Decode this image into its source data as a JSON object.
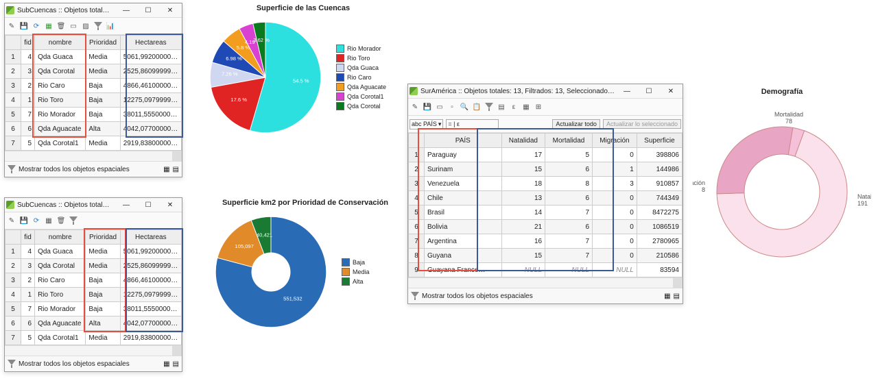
{
  "win1": {
    "title": "SubCuencas :: Objetos total…",
    "status": "Mostrar todos los objetos espaciales",
    "cols": [
      "fid",
      "nombre",
      "Prioridad",
      "Hectareas"
    ],
    "rows": [
      {
        "n": "1",
        "fid": "4",
        "nombre": "Qda Guaca",
        "prioridad": "Media",
        "hect": "5061,99200000…"
      },
      {
        "n": "2",
        "fid": "3",
        "nombre": "Qda Corotal",
        "prioridad": "Media",
        "hect": "2525,86099999…"
      },
      {
        "n": "3",
        "fid": "2",
        "nombre": "Rio Caro",
        "prioridad": "Baja",
        "hect": "4866,46100000…"
      },
      {
        "n": "4",
        "fid": "1",
        "nombre": "Rio Toro",
        "prioridad": "Baja",
        "hect": "12275,0979999…"
      },
      {
        "n": "5",
        "fid": "7",
        "nombre": "Rio Morador",
        "prioridad": "Baja",
        "hect": "38011,5550000…"
      },
      {
        "n": "6",
        "fid": "6",
        "nombre": "Qda Aguacate",
        "prioridad": "Alta",
        "hect": "4042,07700000…"
      },
      {
        "n": "7",
        "fid": "5",
        "nombre": "Qda Corotal1",
        "prioridad": "Media",
        "hect": "2919,83800000…"
      }
    ]
  },
  "win2": {
    "title": "SubCuencas :: Objetos total…",
    "status": "Mostrar todos los objetos espaciales",
    "cols": [
      "fid",
      "nombre",
      "Prioridad",
      "Hectareas"
    ],
    "rows": [
      {
        "n": "1",
        "fid": "4",
        "nombre": "Qda Guaca",
        "prioridad": "Media",
        "hect": "5061,99200000…"
      },
      {
        "n": "2",
        "fid": "3",
        "nombre": "Qda Corotal",
        "prioridad": "Media",
        "hect": "2525,86099999…"
      },
      {
        "n": "3",
        "fid": "2",
        "nombre": "Rio Caro",
        "prioridad": "Baja",
        "hect": "4866,46100000…"
      },
      {
        "n": "4",
        "fid": "1",
        "nombre": "Rio Toro",
        "prioridad": "Baja",
        "hect": "12275,0979999…"
      },
      {
        "n": "5",
        "fid": "7",
        "nombre": "Rio Morador",
        "prioridad": "Baja",
        "hect": "38011,5550000…"
      },
      {
        "n": "6",
        "fid": "6",
        "nombre": "Qda Aguacate",
        "prioridad": "Alta",
        "hect": "4042,07700000…"
      },
      {
        "n": "7",
        "fid": "5",
        "nombre": "Qda Corotal1",
        "prioridad": "Media",
        "hect": "2919,83800000…"
      }
    ]
  },
  "chart1": {
    "title": "Superficie de las Cuencas",
    "legend": [
      "Rio Morador",
      "Rio Toro",
      "Qda Guaca",
      "Rio Caro",
      "Qda Aguacate",
      "Qda Corotal1",
      "Qda Corotal"
    ],
    "colors": [
      "#2ce0e0",
      "#e02424",
      "#cfd8f0",
      "#1f49b5",
      "#f29d1f",
      "#d941d1",
      "#0a7a1f"
    ],
    "labels": [
      "54.5 %",
      "17.6 %",
      "7.26 %",
      "6.98 %",
      "5.8 %",
      "4.19 %",
      "3.62 %"
    ]
  },
  "chart2": {
    "title": "Superficie km2 por Prioridad de Conservación",
    "legend": [
      "Baja",
      "Media",
      "Alta"
    ],
    "colors": [
      "#2a6bb5",
      "#e08a2a",
      "#1a7a33"
    ],
    "labels": [
      "551,532",
      "105,097",
      "40,421"
    ]
  },
  "win3": {
    "title": "SurAmérica :: Objetos totales: 13, Filtrados: 13, Seleccionado…",
    "status": "Mostrar todos los objetos espaciales",
    "field_type": "abc PAÍS",
    "expr": "= | ε",
    "btn_update": "Actualizar todo",
    "btn_update_sel": "Actualizar lo seleccionado",
    "cols": [
      "PAÍS",
      "Natalidad",
      "Mortalidad",
      "Migración",
      "Superficie"
    ],
    "rows": [
      {
        "n": "1",
        "pais": "Paraguay",
        "nat": "17",
        "mor": "5",
        "mig": "0",
        "sup": "398806"
      },
      {
        "n": "2",
        "pais": "Surinam",
        "nat": "15",
        "mor": "6",
        "mig": "1",
        "sup": "144986"
      },
      {
        "n": "3",
        "pais": "Venezuela",
        "nat": "18",
        "mor": "8",
        "mig": "3",
        "sup": "910857"
      },
      {
        "n": "4",
        "pais": "Chile",
        "nat": "13",
        "mor": "6",
        "mig": "0",
        "sup": "744349"
      },
      {
        "n": "5",
        "pais": "Brasil",
        "nat": "14",
        "mor": "7",
        "mig": "0",
        "sup": "8472275"
      },
      {
        "n": "6",
        "pais": "Bolivia",
        "nat": "21",
        "mor": "6",
        "mig": "0",
        "sup": "1086519"
      },
      {
        "n": "7",
        "pais": "Argentina",
        "nat": "16",
        "mor": "7",
        "mig": "0",
        "sup": "2780965"
      },
      {
        "n": "8",
        "pais": "Guyana",
        "nat": "15",
        "mor": "7",
        "mig": "0",
        "sup": "210586"
      },
      {
        "n": "9",
        "pais": "Guayana France…",
        "nat": "NULL",
        "mor": "NULL",
        "mig": "NULL",
        "sup": "83594"
      }
    ]
  },
  "chart3": {
    "title": "Demografía",
    "labels": {
      "nat": "Natalidad",
      "nat_v": "191",
      "mor": "Mortalidad",
      "mor_v": "78",
      "mig": "Migración",
      "mig_v": "8"
    }
  },
  "chart_data": [
    {
      "type": "pie",
      "title": "Superficie de las Cuencas",
      "series": [
        {
          "name": "Rio Morador",
          "value": 54.5
        },
        {
          "name": "Rio Toro",
          "value": 17.6
        },
        {
          "name": "Qda Guaca",
          "value": 7.26
        },
        {
          "name": "Rio Caro",
          "value": 6.98
        },
        {
          "name": "Qda Aguacate",
          "value": 5.8
        },
        {
          "name": "Qda Corotal1",
          "value": 4.19
        },
        {
          "name": "Qda Corotal",
          "value": 3.62
        }
      ]
    },
    {
      "type": "pie",
      "title": "Superficie km2 por Prioridad de Conservación",
      "series": [
        {
          "name": "Baja",
          "value": 551.532
        },
        {
          "name": "Media",
          "value": 105.097
        },
        {
          "name": "Alta",
          "value": 40.421
        }
      ]
    },
    {
      "type": "pie",
      "title": "Demografía",
      "series": [
        {
          "name": "Natalidad",
          "value": 191
        },
        {
          "name": "Mortalidad",
          "value": 78
        },
        {
          "name": "Migración",
          "value": 8
        }
      ]
    }
  ]
}
